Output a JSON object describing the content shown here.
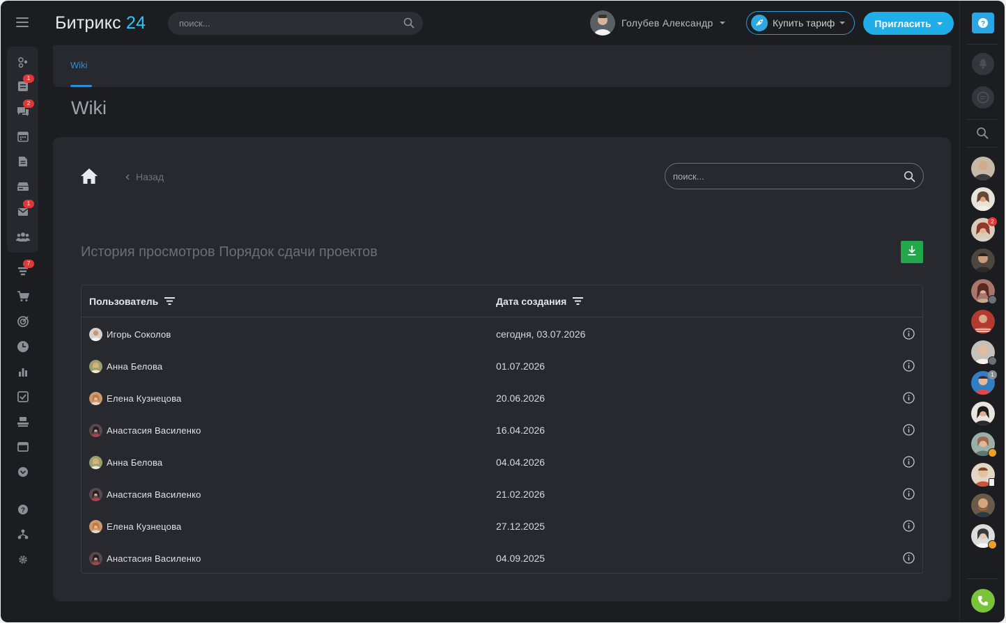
{
  "app": {
    "logo_text": "Битрикс",
    "logo_num": "24"
  },
  "header": {
    "search_placeholder": "поиск...",
    "user_name": "Голубев Александр",
    "buy_label": "Купить тариф",
    "invite_label": "Пригласить"
  },
  "left_nav": {
    "badges": {
      "feed": "1",
      "chat": "2",
      "mail": "1",
      "crm": "7"
    }
  },
  "right_bar": {
    "badges": {
      "contact3": "2",
      "contact8": "1"
    }
  },
  "tabs": [
    {
      "label": "Wiki"
    }
  ],
  "page_title": "Wiki",
  "toolbar": {
    "back_label": "Назад",
    "search_placeholder": "поиск..."
  },
  "history_title": "История просмотров Порядок сдачи проектов",
  "table": {
    "columns": [
      "Пользователь",
      "Дата создания"
    ],
    "rows": [
      {
        "user": "Игорь Соколов",
        "date": "сегодня, 03.07.2026"
      },
      {
        "user": "Анна Белова",
        "date": "01.07.2026"
      },
      {
        "user": "Елена Кузнецова",
        "date": "20.06.2026"
      },
      {
        "user": "Анастасия Василенко",
        "date": "16.04.2026"
      },
      {
        "user": "Анна Белова",
        "date": "04.04.2026"
      },
      {
        "user": "Анастасия Василенко",
        "date": "21.02.2026"
      },
      {
        "user": "Елена Кузнецова",
        "date": "27.12.2025"
      },
      {
        "user": "Анастасия Василенко",
        "date": "04.09.2025"
      }
    ]
  },
  "colors": {
    "accent": "#2fc6f6",
    "invite": "#1faee8",
    "download": "#22a74a",
    "call": "#7ac43a"
  }
}
